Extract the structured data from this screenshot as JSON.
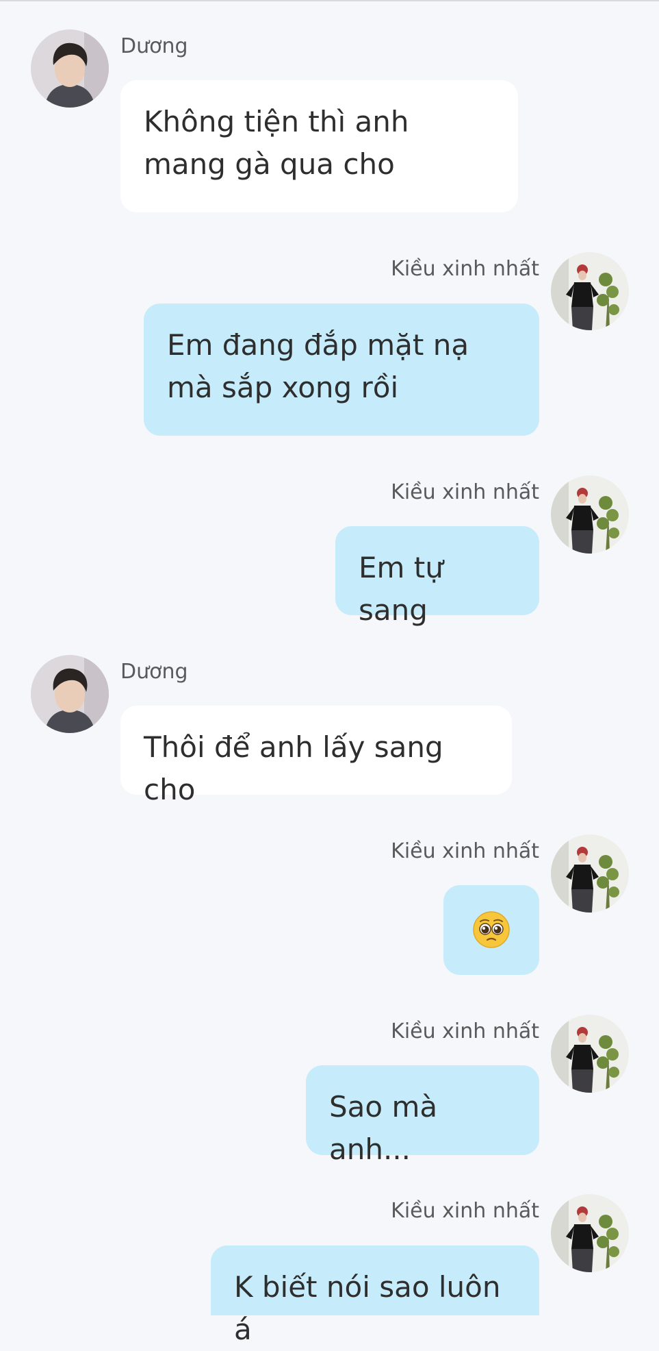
{
  "conversation": {
    "participants": {
      "other": "Dương",
      "me": "Kiều xinh nhất"
    },
    "messages": [
      {
        "sender": "Dương",
        "side": "left",
        "text": "Không tiện thì anh mang gà qua cho"
      },
      {
        "sender": "Kiều xinh nhất",
        "side": "right",
        "text": "Em đang đắp mặt nạ mà sắp xong rồi"
      },
      {
        "sender": "Kiều xinh nhất",
        "side": "right",
        "text": "Em tự sang"
      },
      {
        "sender": "Dương",
        "side": "left",
        "text": "Thôi để anh lấy sang cho"
      },
      {
        "sender": "Kiều xinh nhất",
        "side": "right",
        "text": "",
        "emoji": "pleading-face-emoji"
      },
      {
        "sender": "Kiều xinh nhất",
        "side": "right",
        "text": "Sao mà anh..."
      },
      {
        "sender": "Kiều xinh nhất",
        "side": "right",
        "text": "K biết nói sao luôn á"
      }
    ]
  },
  "colors": {
    "background": "#f5f7fa",
    "incoming_bubble": "#ffffff",
    "outgoing_bubble": "#c6ecfb",
    "sender_text": "#5a5a5a",
    "message_text": "#2e2e2e"
  }
}
